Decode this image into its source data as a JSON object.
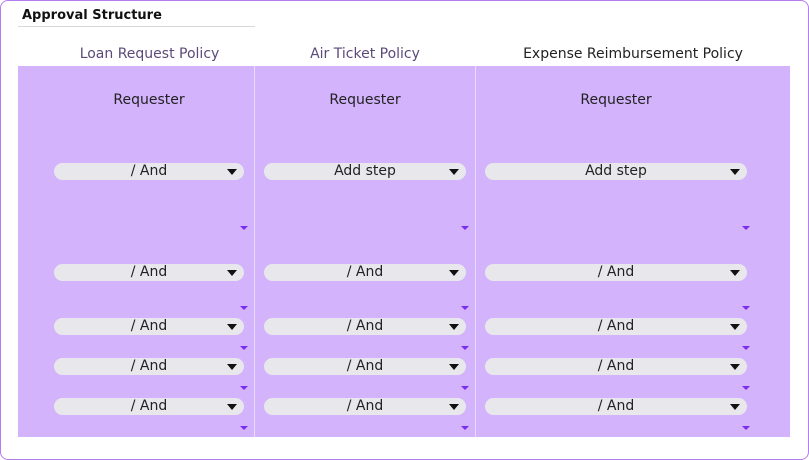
{
  "section": {
    "title": "Approval Structure"
  },
  "columns": [
    {
      "header": "Loan Request Policy",
      "header_color": "#5b4a7a",
      "requester_label": "Requester",
      "selects": [
        "/ And",
        "/ And",
        "/ And",
        "/ And",
        "/ And"
      ]
    },
    {
      "header": "Air Ticket Policy",
      "header_color": "#5b4a7a",
      "requester_label": "Requester",
      "selects": [
        "Add step",
        "/ And",
        "/ And",
        "/ And",
        "/ And"
      ]
    },
    {
      "header": "Expense Reimbursement Policy",
      "header_color": "#222222",
      "requester_label": "Requester",
      "selects": [
        "Add step",
        "/ And",
        "/ And",
        "/ And",
        "/ And"
      ]
    }
  ],
  "colors": {
    "panel": "#d3b3fc",
    "frame_border": "#b57cf0",
    "select_bg": "#e8e8ec",
    "mini_caret": "#7a2cf0"
  },
  "icons": {
    "select_caret": "caret-down-icon",
    "expand_caret": "chevron-down-icon"
  }
}
